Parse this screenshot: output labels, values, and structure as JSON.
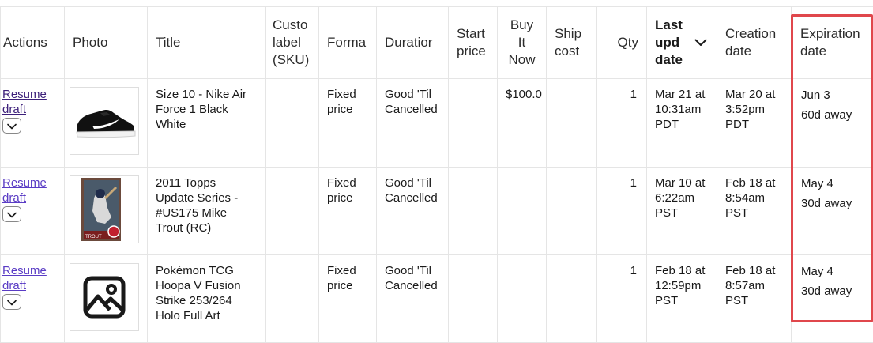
{
  "headers": {
    "actions": "Actions",
    "photo": "Photo",
    "title": "Title",
    "sku": [
      "Custo",
      "label",
      "(SKU)"
    ],
    "format": "Forma",
    "duration": "Duratior",
    "start_price": [
      "Start",
      "price"
    ],
    "buy_now": [
      "Buy",
      "It",
      "Now"
    ],
    "ship_cost": [
      "Ship",
      "cost"
    ],
    "qty": "Qty",
    "last_updated": [
      "Last",
      "upd",
      "date"
    ],
    "creation_date": [
      "Creation",
      "date"
    ],
    "expiration_date": [
      "Expiration",
      "date"
    ]
  },
  "sort_icon": "chevron-down-icon",
  "highlight_color": "#e0474c",
  "rows": [
    {
      "action_label": [
        "Resume",
        "draft"
      ],
      "photo_icon": "sneaker-photo",
      "title": [
        "Size 10 - Nike Air",
        "Force 1 Black",
        "White"
      ],
      "sku": "",
      "format": [
        "Fixed",
        "price"
      ],
      "duration": [
        "Good 'Til",
        "Cancelled"
      ],
      "start_price": "",
      "buy_now": "$100.0",
      "ship_cost": "",
      "qty": "1",
      "last_updated": [
        "Mar 21 at",
        "10:31am",
        "PDT"
      ],
      "creation_date": [
        "Mar 20 at",
        "3:52pm",
        "PDT"
      ],
      "expiration": [
        "Jun 3",
        "60d away"
      ]
    },
    {
      "action_label": [
        "Resume",
        "draft"
      ],
      "photo_icon": "baseball-card-photo",
      "title": [
        "2011 Topps",
        "Update Series -",
        "#US175 Mike",
        "Trout (RC)"
      ],
      "sku": "",
      "format": [
        "Fixed",
        "price"
      ],
      "duration": [
        "Good 'Til",
        "Cancelled"
      ],
      "start_price": "",
      "buy_now": "",
      "ship_cost": "",
      "qty": "1",
      "last_updated": [
        "Mar 10 at",
        "6:22am",
        "PST"
      ],
      "creation_date": [
        "Feb 18 at",
        "8:54am",
        "PST"
      ],
      "expiration": [
        "May 4",
        "30d away"
      ]
    },
    {
      "action_label": [
        "Resume",
        "draft"
      ],
      "photo_icon": "image-placeholder-icon",
      "title": [
        "Pokémon TCG",
        "Hoopa V Fusion",
        "Strike 253/264",
        "Holo Full Art"
      ],
      "sku": "",
      "format": [
        "Fixed",
        "price"
      ],
      "duration": [
        "Good 'Til",
        "Cancelled"
      ],
      "start_price": "",
      "buy_now": "",
      "ship_cost": "",
      "qty": "1",
      "last_updated": [
        "Feb 18 at",
        "12:59pm",
        "PST"
      ],
      "creation_date": [
        "Feb 18 at",
        "8:57am",
        "PST"
      ],
      "expiration": [
        "May 4",
        "30d away"
      ]
    }
  ]
}
